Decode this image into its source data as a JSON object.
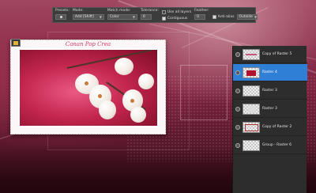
{
  "toolbar": {
    "presets_label": "Presets:",
    "mode_label": "Mode:",
    "mode_value": "Add [Shift]",
    "match_mode_label": "Match mode:",
    "match_mode_value": "Color",
    "tolerance_label": "Tolerance:",
    "tolerance_value": "0",
    "use_all_layers_label": "Use all layers",
    "contiguous_label": "Contiguous",
    "contiguous_checked": true,
    "feather_label": "Feather:",
    "feather_value": "0",
    "antialias_label": "Anti-alias",
    "antialias_value": "Outside"
  },
  "card": {
    "title": "Canan Pop Crea"
  },
  "layers": [
    {
      "name": "Copy of Raster 5",
      "selected": false,
      "thumb": "text"
    },
    {
      "name": "Raster 4",
      "selected": true,
      "thumb": "red-rect"
    },
    {
      "name": "Raster 3",
      "selected": false,
      "thumb": "empty"
    },
    {
      "name": "Raster 3",
      "selected": false,
      "thumb": "photo"
    },
    {
      "name": "Copy of Raster 2",
      "selected": false,
      "thumb": "frame"
    },
    {
      "name": "Group - Raster 6",
      "selected": false,
      "thumb": "empty"
    }
  ],
  "colors": {
    "accent": "#2f7fd6",
    "background": "#7d2340",
    "panel": "#2d2d2d",
    "title": "#d3366b"
  }
}
